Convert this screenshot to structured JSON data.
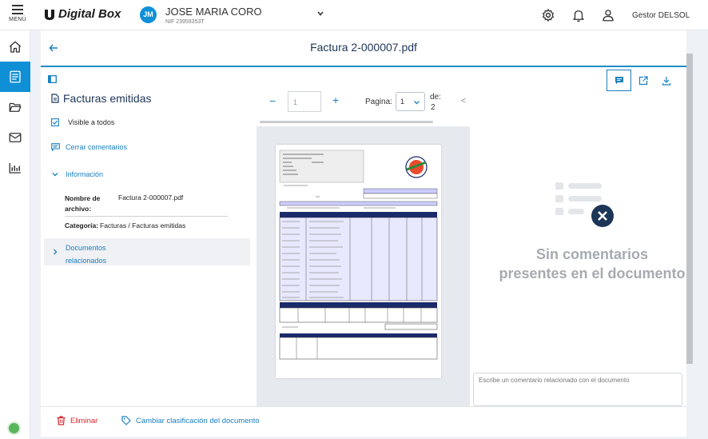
{
  "app": {
    "menu_label": "MENÚ",
    "brand": "Digital Box"
  },
  "user": {
    "initials": "JM",
    "name": "JOSE MARIA CORO",
    "nif": "NIF 23959353T",
    "role": "Gestor DELSOL"
  },
  "document": {
    "title": "Factura 2-000007.pdf"
  },
  "left": {
    "section_title": "Facturas emitidas",
    "visible_label": "Visible a todos",
    "close_comments": "Cerrar comentarios",
    "info_label": "Información",
    "filename_label": "Nombre de archivo:",
    "filename_value": "Factura 2-000007.pdf",
    "category_label": "Categoría:",
    "category_value": "Facturas / Facturas emitidas",
    "related_label": "Documentos relacionados"
  },
  "viewer": {
    "zoom_minus": "−",
    "zoom_value": "1",
    "zoom_plus": "+",
    "page_label": "Pagina:",
    "page_selected": "1",
    "page_of_label": "de:",
    "page_total": "2",
    "prev": "<"
  },
  "comments": {
    "empty_line1": "Sin comentarios",
    "empty_line2": "presentes en el documento",
    "placeholder": "Escribe un comentario relacionado con el documento"
  },
  "footer": {
    "delete_label": "Eliminar",
    "reclassify_label": "Cambiar clasificación del documento"
  },
  "colors": {
    "accent": "#0f8fd6",
    "danger": "#d0262d",
    "link": "#1a7fc0"
  },
  "icons": {
    "sidebar": [
      "home-icon",
      "documents-icon",
      "folder-icon",
      "mail-icon",
      "chart-icon"
    ],
    "top": [
      "gear-icon",
      "bell-icon",
      "user-icon"
    ],
    "comments": [
      "comment-icon",
      "external-link-icon",
      "download-icon"
    ]
  }
}
